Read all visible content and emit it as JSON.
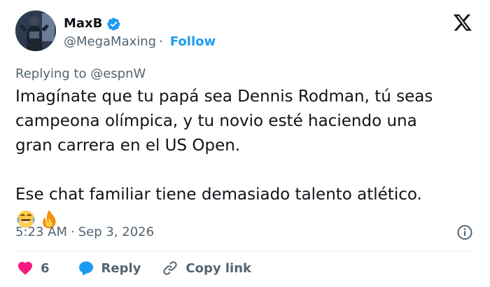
{
  "author": {
    "name": "MaxB",
    "handle": "@MegaMaxing",
    "separator": "·",
    "follow_label": "Follow"
  },
  "reply_context": "Replying to @espnW",
  "tweet": {
    "lines": [
      "Imagínate que tu papá sea Dennis Rodman, tú seas",
      "campeona olímpica, y tu novio esté haciendo una",
      "gran carrera en el US Open.",
      "Ese chat familiar tiene demasiado talento atlético."
    ],
    "emojis": [
      "laughing-tears-emoji",
      "fire-emoji"
    ]
  },
  "meta": {
    "time": "5:23 AM",
    "separator": "·",
    "date": "Sep 3, 2026"
  },
  "actions": {
    "like_count": "6",
    "reply_label": "Reply",
    "copy_label": "Copy link"
  },
  "colors": {
    "accent": "#1d9bf0",
    "like": "#f91880",
    "text": "#0f1419",
    "muted": "#536471"
  }
}
